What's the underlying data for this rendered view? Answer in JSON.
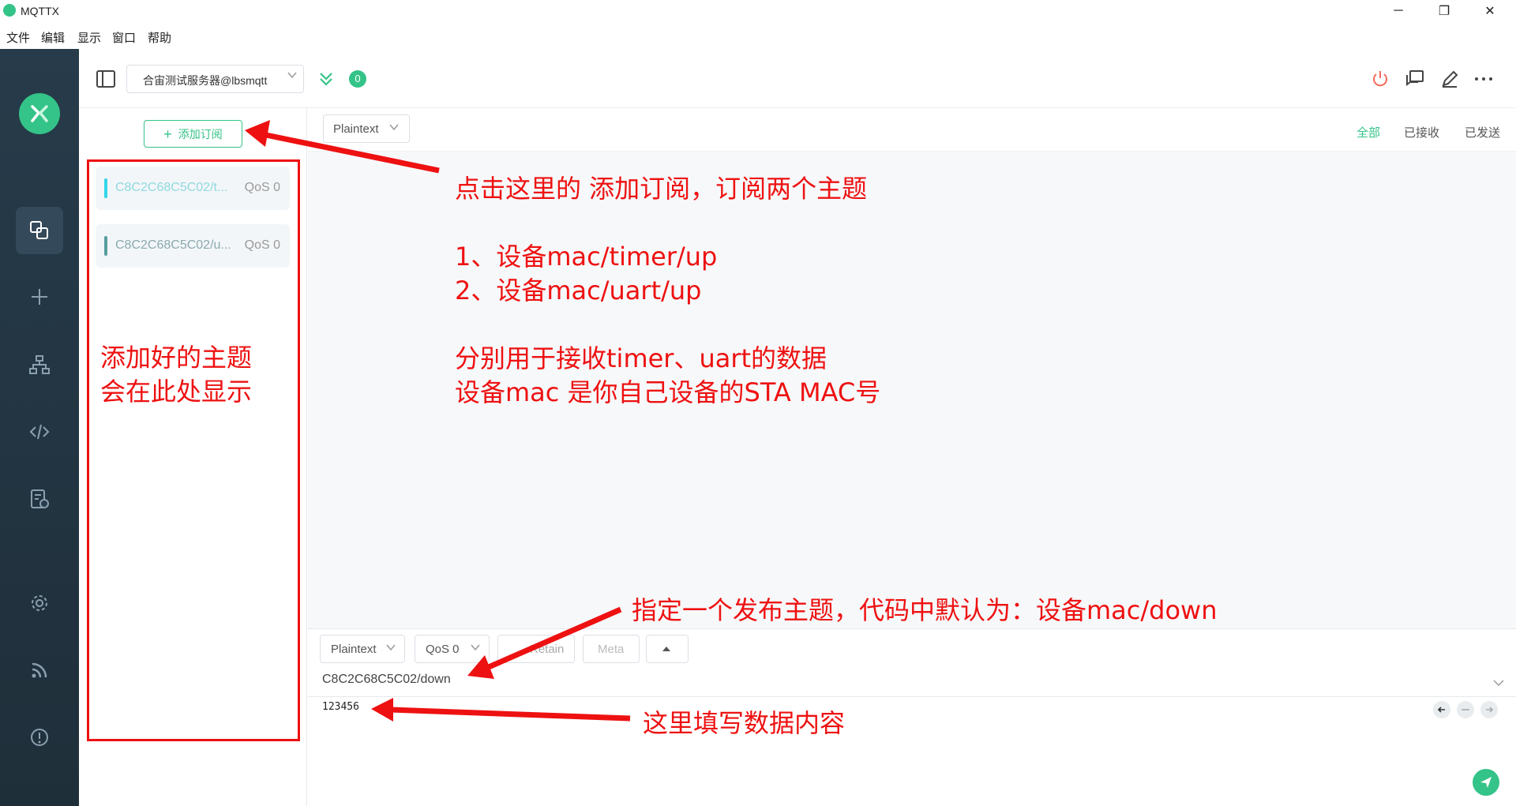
{
  "window": {
    "title": "MQTTX",
    "minimize": "─",
    "restore": "❐",
    "close": "✕"
  },
  "menu": [
    "文件",
    "编辑",
    "显示",
    "窗口",
    "帮助"
  ],
  "header": {
    "connection": "合宙测试服务器@lbsmqtt",
    "badge": "0"
  },
  "subscriptions": {
    "add_label": "添加订阅",
    "items": [
      {
        "topic": "C8C2C68C5C02/t...",
        "qos": "QoS 0",
        "color": "#33d6e8"
      },
      {
        "topic": "C8C2C68C5C02/u...",
        "qos": "QoS 0",
        "color": "#5a9e9e"
      }
    ]
  },
  "messages": {
    "format": "Plaintext",
    "filters": [
      "全部",
      "已接收",
      "已发送"
    ]
  },
  "composer": {
    "format": "Plaintext",
    "qos": "QoS 0",
    "retain": "Retain",
    "meta": "Meta",
    "topic": "C8C2C68C5C02/down",
    "payload": "123456"
  },
  "annotations": {
    "box_text": [
      "添加好的主题",
      "会在此处显示"
    ],
    "main_text": [
      "点击这里的 添加订阅，订阅两个主题",
      "",
      "1、设备mac/timer/up",
      "2、设备mac/uart/up",
      "",
      "分别用于接收timer、uart的数据",
      "设备mac 是你自己设备的STA MAC号"
    ],
    "publish_text": "指定一个发布主题，代码中默认为：设备mac/down",
    "payload_text": "这里填写数据内容"
  },
  "colors": {
    "accent": "#34c388",
    "annotation": "#ee1111",
    "nav_bg": "#273b4a"
  }
}
